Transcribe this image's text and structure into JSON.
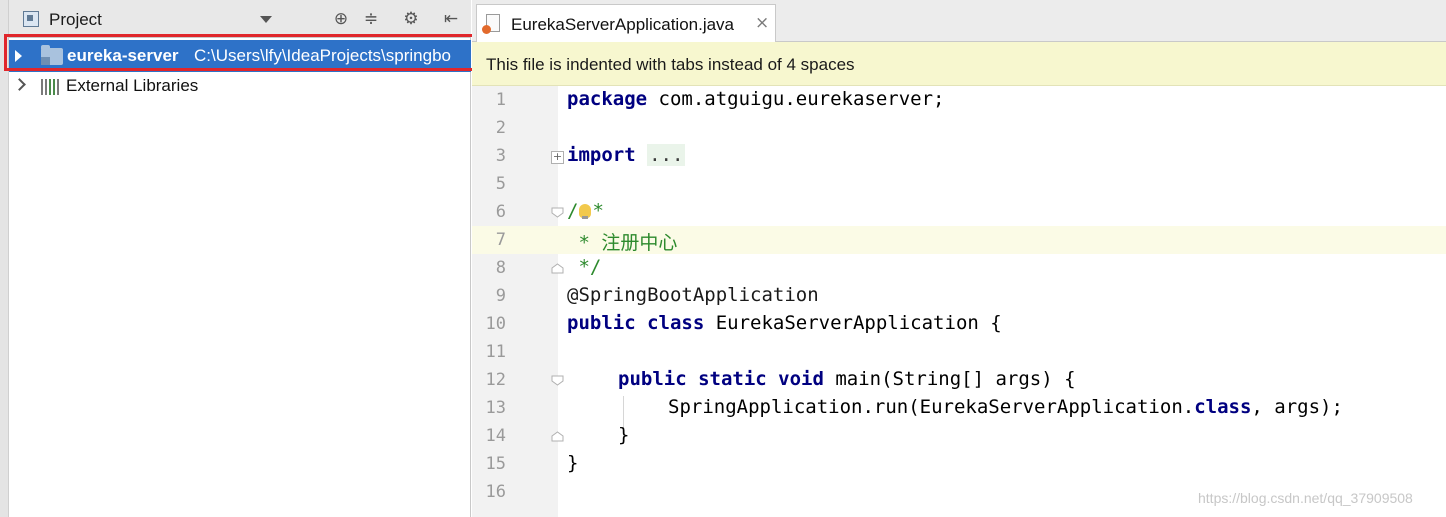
{
  "project_panel": {
    "title": "Project",
    "tools": [
      "target-icon",
      "collapse-icon",
      "gear-icon",
      "hide-panel-icon"
    ],
    "tree": [
      {
        "name": "eureka-server",
        "path": "C:\\Users\\lfy\\IdeaProjects\\springbo",
        "selected": true,
        "highlighted": true
      },
      {
        "name": "External Libraries",
        "selected": false
      }
    ]
  },
  "editor": {
    "tab_label": "EurekaServerApplication.java",
    "tab_close": "×",
    "notice": "This file is indented with tabs instead of 4 spaces",
    "caret_line": 7,
    "lines": [
      {
        "n": "1"
      },
      {
        "n": "2"
      },
      {
        "n": "3"
      },
      {
        "n": "5"
      },
      {
        "n": "6"
      },
      {
        "n": "7"
      },
      {
        "n": "8"
      },
      {
        "n": "9"
      },
      {
        "n": "10"
      },
      {
        "n": "11"
      },
      {
        "n": "12"
      },
      {
        "n": "13"
      },
      {
        "n": "14"
      },
      {
        "n": "15"
      },
      {
        "n": "16"
      }
    ],
    "code": {
      "l1_kw": "package",
      "l1_rest": " com.atguigu.eurekaserver;",
      "l3_kw": "import",
      "l3_fold": "...",
      "l6": "/",
      "l6_star": "*",
      "l7": " * 注册中心",
      "l8": " */",
      "l9": "@SpringBootApplication",
      "l10_kw": "public class",
      "l10_rest": " EurekaServerApplication {",
      "l12_kw": "public static void",
      "l12_rest": " main(String[] args) {",
      "l13_a": "SpringApplication.run(EurekaServerApplication.",
      "l13_kw": "class",
      "l13_b": ", args);",
      "l14": "}",
      "l15": "}"
    }
  },
  "watermark": "https://blog.csdn.net/qq_37909508",
  "colors": {
    "selection": "#2e72c8",
    "highlight_box": "#e0262b",
    "notice_bg": "#f7f7cf",
    "keyword": "#000080",
    "comment": "#2d8a2d"
  }
}
